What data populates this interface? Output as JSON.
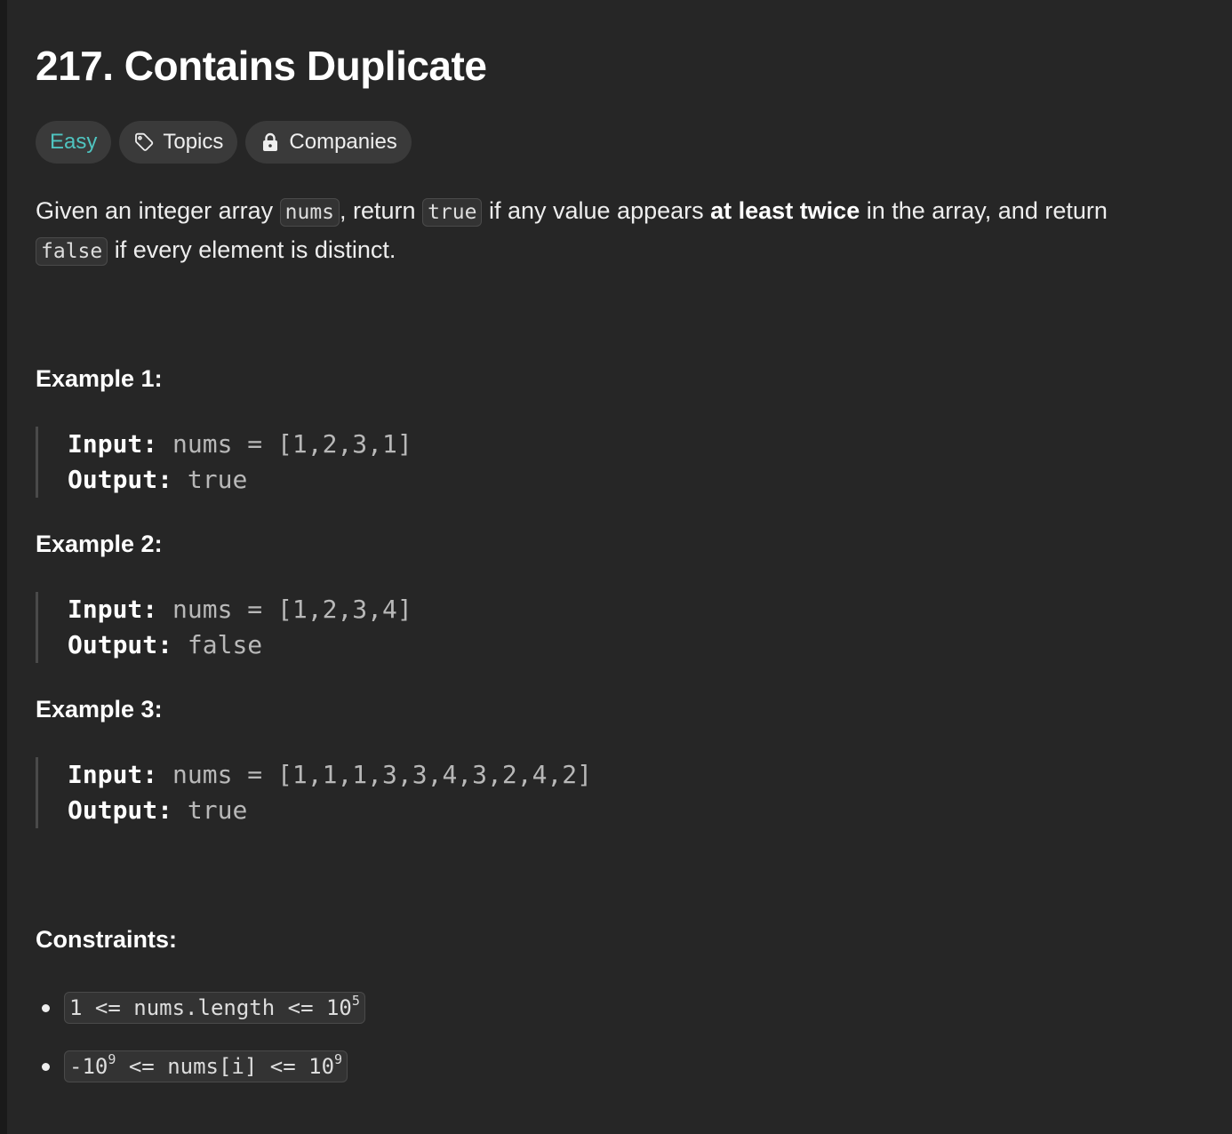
{
  "problem": {
    "title": "217. Contains Duplicate",
    "difficulty": "Easy",
    "tags": [
      {
        "label": "Topics",
        "icon": "tag-icon"
      },
      {
        "label": "Companies",
        "icon": "lock-icon"
      }
    ],
    "colors": {
      "background": "#262626",
      "easy": "#4fc4c0",
      "tag_bg": "#3a3a3a"
    }
  },
  "description": {
    "t1": "Given an integer array ",
    "code_nums": "nums",
    "t2": ", return ",
    "code_true": "true",
    "t3": " if any value appears ",
    "bold": "at least twice",
    "t4": " in the array, and return ",
    "code_false": "false",
    "t5": " if every element is distinct."
  },
  "examples": [
    {
      "title": "Example 1:",
      "input_label": "Input:",
      "input": " nums = [1,2,3,1]",
      "output_label": "Output:",
      "output": " true"
    },
    {
      "title": "Example 2:",
      "input_label": "Input:",
      "input": " nums = [1,2,3,4]",
      "output_label": "Output:",
      "output": " false"
    },
    {
      "title": "Example 3:",
      "input_label": "Input:",
      "input": " nums = [1,1,1,3,3,4,3,2,4,2]",
      "output_label": "Output:",
      "output": " true"
    }
  ],
  "constraints": {
    "title": "Constraints:",
    "c1": {
      "text": "1 <= nums.length <= 10",
      "sup": "5"
    },
    "c2": {
      "p1": "-10",
      "sup1": "9",
      "p2": " <= nums[i] <= 10",
      "sup2": "9"
    }
  }
}
